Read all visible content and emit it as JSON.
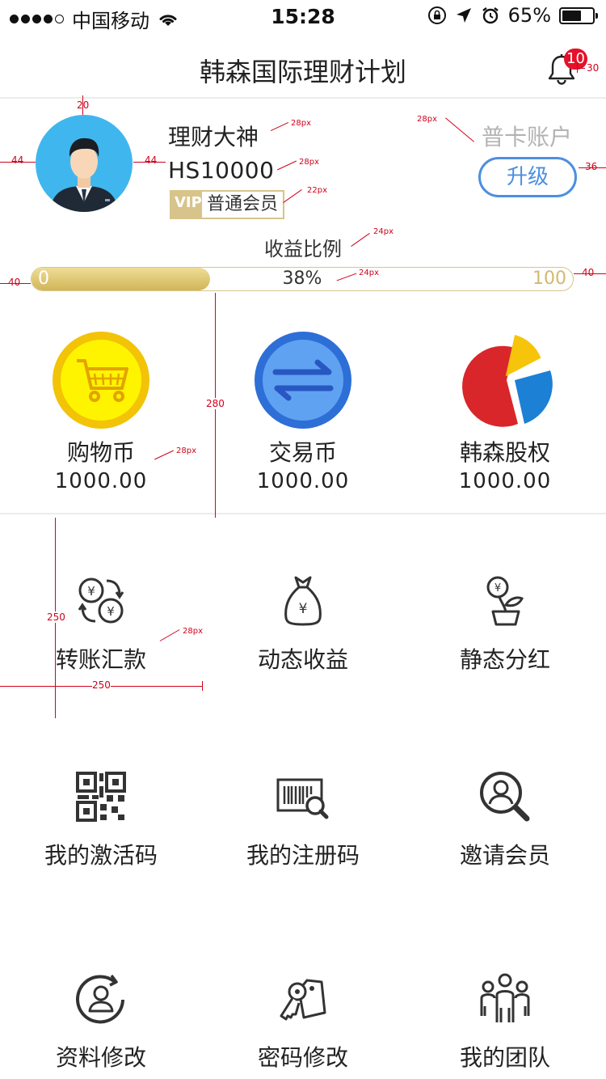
{
  "status_bar": {
    "carrier": "中国移动",
    "time": "15:28",
    "battery": "65%",
    "battery_level": 0.65
  },
  "nav": {
    "title": "韩森国际理财计划",
    "notification_count": "10"
  },
  "profile": {
    "name": "理财大神",
    "id": "HS10000",
    "vip_logo": "VIP",
    "member_level": "普通会员",
    "account_type": "普卡账户",
    "upgrade_label": "升级"
  },
  "progress": {
    "title": "收益比例",
    "min": "0",
    "max": "100",
    "percent_label": "38%",
    "value": 0.33
  },
  "coins": [
    {
      "name": "购物币",
      "value": "1000.00",
      "icon": "shopping-cart-icon"
    },
    {
      "name": "交易币",
      "value": "1000.00",
      "icon": "exchange-arrows-icon"
    },
    {
      "name": "韩森股权",
      "value": "1000.00",
      "icon": "pie-chart-icon"
    }
  ],
  "menu": [
    {
      "label": "转账汇款",
      "icon": "currency-transfer-icon"
    },
    {
      "label": "动态收益",
      "icon": "money-bag-icon"
    },
    {
      "label": "静态分红",
      "icon": "money-plant-icon"
    },
    {
      "label": "我的激活码",
      "icon": "qr-code-icon"
    },
    {
      "label": "我的注册码",
      "icon": "barcode-search-icon"
    },
    {
      "label": "邀请会员",
      "icon": "user-search-icon"
    },
    {
      "label": "资料修改",
      "icon": "user-refresh-icon"
    },
    {
      "label": "密码修改",
      "icon": "key-tag-icon"
    },
    {
      "label": "我的团队",
      "icon": "team-icon"
    }
  ],
  "annotations": {
    "px28": "28px",
    "px22": "22px",
    "px24": "24px",
    "n20": "20",
    "n44": "44",
    "n30": "30",
    "n36": "36",
    "n40": "40",
    "n280": "280",
    "n250": "250"
  },
  "colors": {
    "accent_blue": "#4d8fe0",
    "gold": "#d8c48a",
    "badge_red": "#e5112a",
    "annotation_red": "#d0021b"
  }
}
